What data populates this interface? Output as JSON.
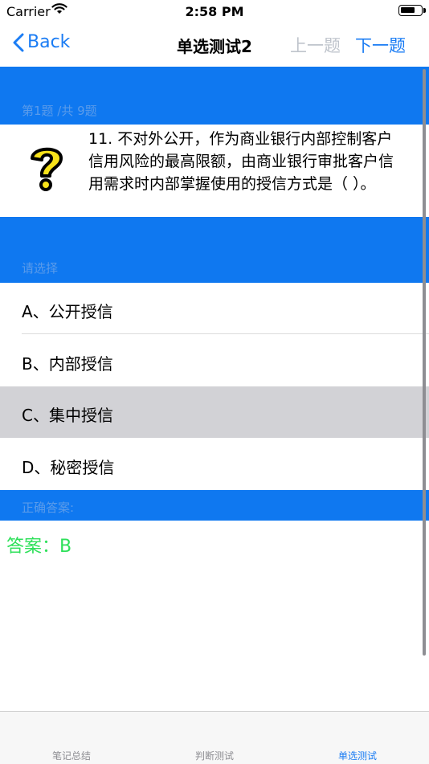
{
  "status": {
    "carrier": "Carrier",
    "time": "2:58 PM"
  },
  "nav": {
    "back_label": "Back",
    "title": "单选测试2",
    "prev_label": "上一题",
    "next_label": "下一题"
  },
  "question": {
    "progress": "第1题 /共 9题",
    "text": "11. 不对外公开，作为商业银行内部控制客户信用风险的最高限额，由商业银行审批客户信用需求时内部掌握使用的授信方式是（ ）。",
    "icon": "question-mark-icon"
  },
  "choices": {
    "label": "请选择",
    "options": [
      "A、公开授信",
      "B、内部授信",
      "C、集中授信",
      "D、秘密授信"
    ],
    "selected_index": 2
  },
  "answer": {
    "section_label": "正确答案:",
    "text": "答案：B"
  },
  "tabs": [
    {
      "label": "笔记总结",
      "active": false
    },
    {
      "label": "判断测试",
      "active": false
    },
    {
      "label": "单选测试",
      "active": true
    }
  ],
  "colors": {
    "accent": "#1a7cf4",
    "band": "#0f78f0",
    "answer": "#2ee05a",
    "selected_row": "#d2d2d6"
  }
}
